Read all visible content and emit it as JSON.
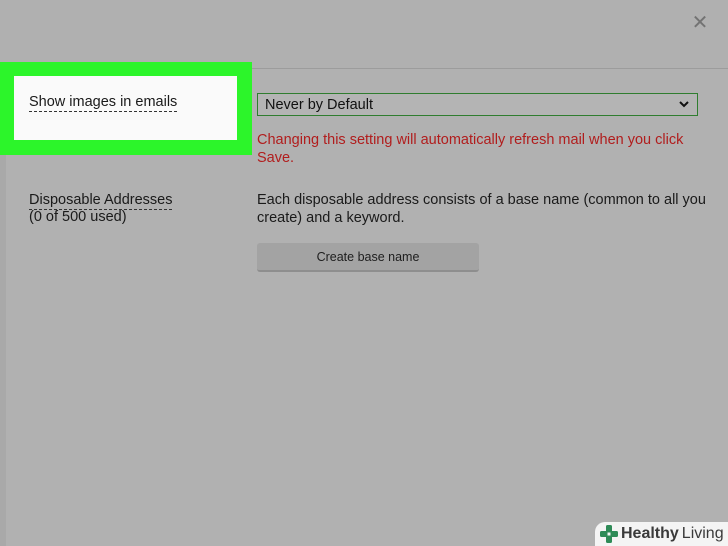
{
  "dialog": {
    "close_glyph": "✕"
  },
  "settings": {
    "show_images": {
      "label": "Show images in emails",
      "selected_option": "Never by Default",
      "warning": "Changing this setting will automatically refresh mail when you click Save."
    },
    "disposable": {
      "label": "Disposable Addresses",
      "usage": "(0 of 500 used)",
      "description": "Each disposable address consists of a base name (common to all you create) and a keyword.",
      "button_label": "Create base name"
    }
  },
  "watermark": {
    "brand_bold": "Healthy",
    "brand_light": "Living",
    "icon": "plus-cross-icon"
  },
  "colors": {
    "highlight": "#2cf52a",
    "warning": "#b11d1d",
    "select_border": "#2f7d2f"
  }
}
